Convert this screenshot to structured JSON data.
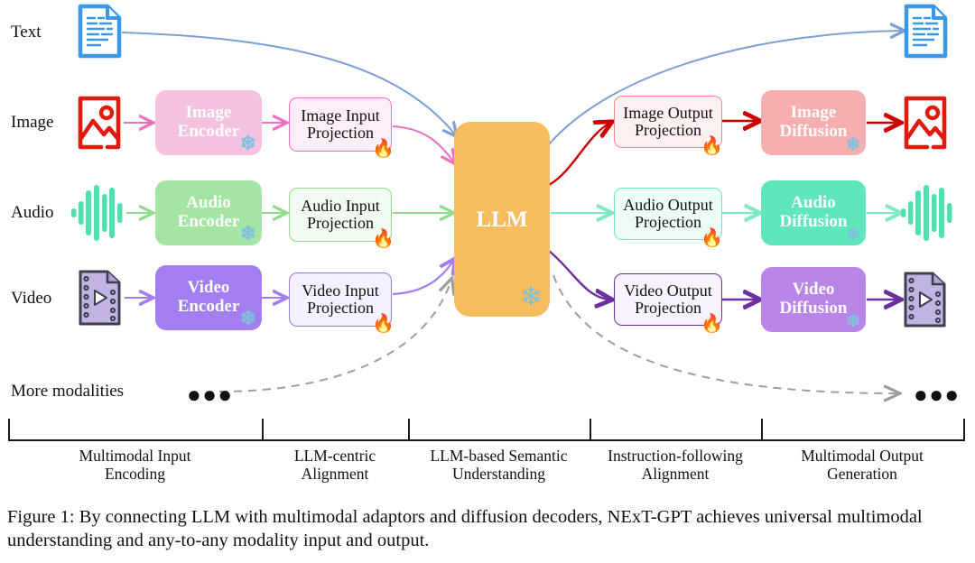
{
  "figure": {
    "caption": "Figure 1: By connecting LLM with multimodal adaptors and diffusion decoders, NExT-GPT achieves universal multimodal understanding and any-to-any modality input and output."
  },
  "modalities": [
    {
      "label": "Text",
      "icon": "text-document-icon",
      "color": "#3b97e8"
    },
    {
      "label": "Image",
      "icon": "image-picture-icon",
      "color": "#e01b0e"
    },
    {
      "label": "Audio",
      "icon": "audio-waveform-icon",
      "color": "#4fe0b0"
    },
    {
      "label": "Video",
      "icon": "video-film-icon",
      "color": "#a78bd9"
    },
    {
      "label": "More modalities",
      "icon": "ellipsis-icon",
      "color": "#111111"
    }
  ],
  "encoders": [
    {
      "name": "Image Encoder",
      "line1": "Image",
      "line2": "Encoder",
      "fill": "#f4c2e0",
      "state": "frozen"
    },
    {
      "name": "Audio Encoder",
      "line1": "Audio",
      "line2": "Encoder",
      "fill": "#a5e5a3",
      "state": "frozen"
    },
    {
      "name": "Video Encoder",
      "line1": "Video",
      "line2": "Encoder",
      "fill": "#a27ef0",
      "state": "frozen"
    }
  ],
  "input_projections": [
    {
      "name": "Image Input Projection",
      "line1": "Image Input",
      "line2": "Projection",
      "border": "#ef6fc0",
      "fill": "#fdeef7",
      "state": "trainable"
    },
    {
      "name": "Audio Input Projection",
      "line1": "Audio Input",
      "line2": "Projection",
      "border": "#8fdc8c",
      "fill": "#f2fbf1",
      "state": "trainable"
    },
    {
      "name": "Video Input Projection",
      "line1": "Video Input",
      "line2": "Projection",
      "border": "#9a7ae0",
      "fill": "#f5f0fd",
      "state": "trainable"
    }
  ],
  "llm": {
    "label": "LLM",
    "fill": "#f6bd60",
    "state": "frozen"
  },
  "output_projections": [
    {
      "name": "Image Output Projection",
      "line1": "Image Output",
      "line2": "Projection",
      "border": "#f08b8b",
      "fill": "#fdf0f0",
      "state": "trainable"
    },
    {
      "name": "Audio Output Projection",
      "line1": "Audio Output",
      "line2": "Projection",
      "border": "#6ee7c4",
      "fill": "#eefcf7",
      "state": "trainable"
    },
    {
      "name": "Video Output Projection",
      "line1": "Video Output",
      "line2": "Projection",
      "border": "#6b2fa0",
      "fill": "#f8f2fd",
      "state": "trainable"
    }
  ],
  "diffusions": [
    {
      "name": "Image Diffusion",
      "line1": "Image",
      "line2": "Diffusion",
      "fill": "#f7aeae",
      "state": "frozen"
    },
    {
      "name": "Audio Diffusion",
      "line1": "Audio",
      "line2": "Diffusion",
      "fill": "#5fe6bd",
      "state": "frozen"
    },
    {
      "name": "Video Diffusion",
      "line1": "Video",
      "line2": "Diffusion",
      "fill": "#b985e8",
      "state": "frozen"
    }
  ],
  "stages": [
    {
      "line1": "Multimodal Input",
      "line2": "Encoding"
    },
    {
      "line1": "LLM-centric",
      "line2": "Alignment"
    },
    {
      "line1": "LLM-based Semantic",
      "line2": "Understanding"
    },
    {
      "line1": "Instruction-following",
      "line2": "Alignment"
    },
    {
      "line1": "Multimodal Output",
      "line2": "Generation"
    }
  ],
  "badges": {
    "frozen_icon": "snowflake-icon",
    "trainable_icon": "flame-icon",
    "frozen_glyph": "❄",
    "trainable_glyph": "🔥"
  },
  "ellipsis": "●●●",
  "colors": {
    "text_blue": "#3b97e8",
    "image_red": "#e01b0e",
    "audio_green": "#4fe0b0",
    "video_purple": "#a27ef0",
    "llm_orange": "#f6bd60",
    "flow_text": "#7b9fd4",
    "flow_image_in": "#ef6fc0",
    "flow_audio_in": "#8fdc8c",
    "flow_video_in": "#a27ef0",
    "flow_image_out": "#cc0000",
    "flow_audio_out": "#7fe8c5",
    "flow_video_out": "#6b2fa0",
    "dashed_gray": "#9e9e9e"
  }
}
